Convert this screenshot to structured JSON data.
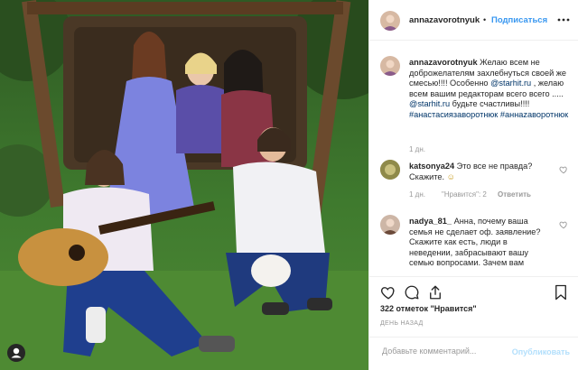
{
  "post": {
    "username": "annazavorotnyuk",
    "separator": "•",
    "follow_label": "Подписаться"
  },
  "caption": {
    "username": "annazavorotnyuk",
    "text_a": "Желаю всем не доброжелателям захлебнуться своей же смесью!!!! Особенно ",
    "mention_1": "@starhit.ru",
    "text_b": " , желаю всем вашим редакторам всего всего ..... ",
    "mention_2": "@starhit.ru",
    "text_c": " будьте счастливы!!!! ",
    "hashtag_1": "#анастасиязаворотнюк",
    "hashtag_2": "#аннazaворотнюк",
    "time": "1 дн."
  },
  "comments": [
    {
      "username": "katsonya24",
      "text": "Это все не правда? Скажите.",
      "emoji": "☺",
      "time": "1 дн.",
      "likes": "\"Нравится\": 2",
      "reply": "Ответить"
    },
    {
      "username": "nadya_81_",
      "text": "Анна, почему ваша семья не сделает оф. заявление? Скажите как есть, люди в неведении, забрасывают вашу семью вопросами. Зачем вам"
    }
  ],
  "actions": {
    "likes_text": "322 отметок \"Нравится\"",
    "date_text": "ДЕНЬ НАЗАД"
  },
  "add_comment": {
    "placeholder": "Добавьте комментарий...",
    "publish_label": "Опубликовать"
  },
  "icons": [
    "heart-icon",
    "comment-icon",
    "share-icon",
    "bookmark-icon",
    "options-icon",
    "user-avatar-icon"
  ]
}
